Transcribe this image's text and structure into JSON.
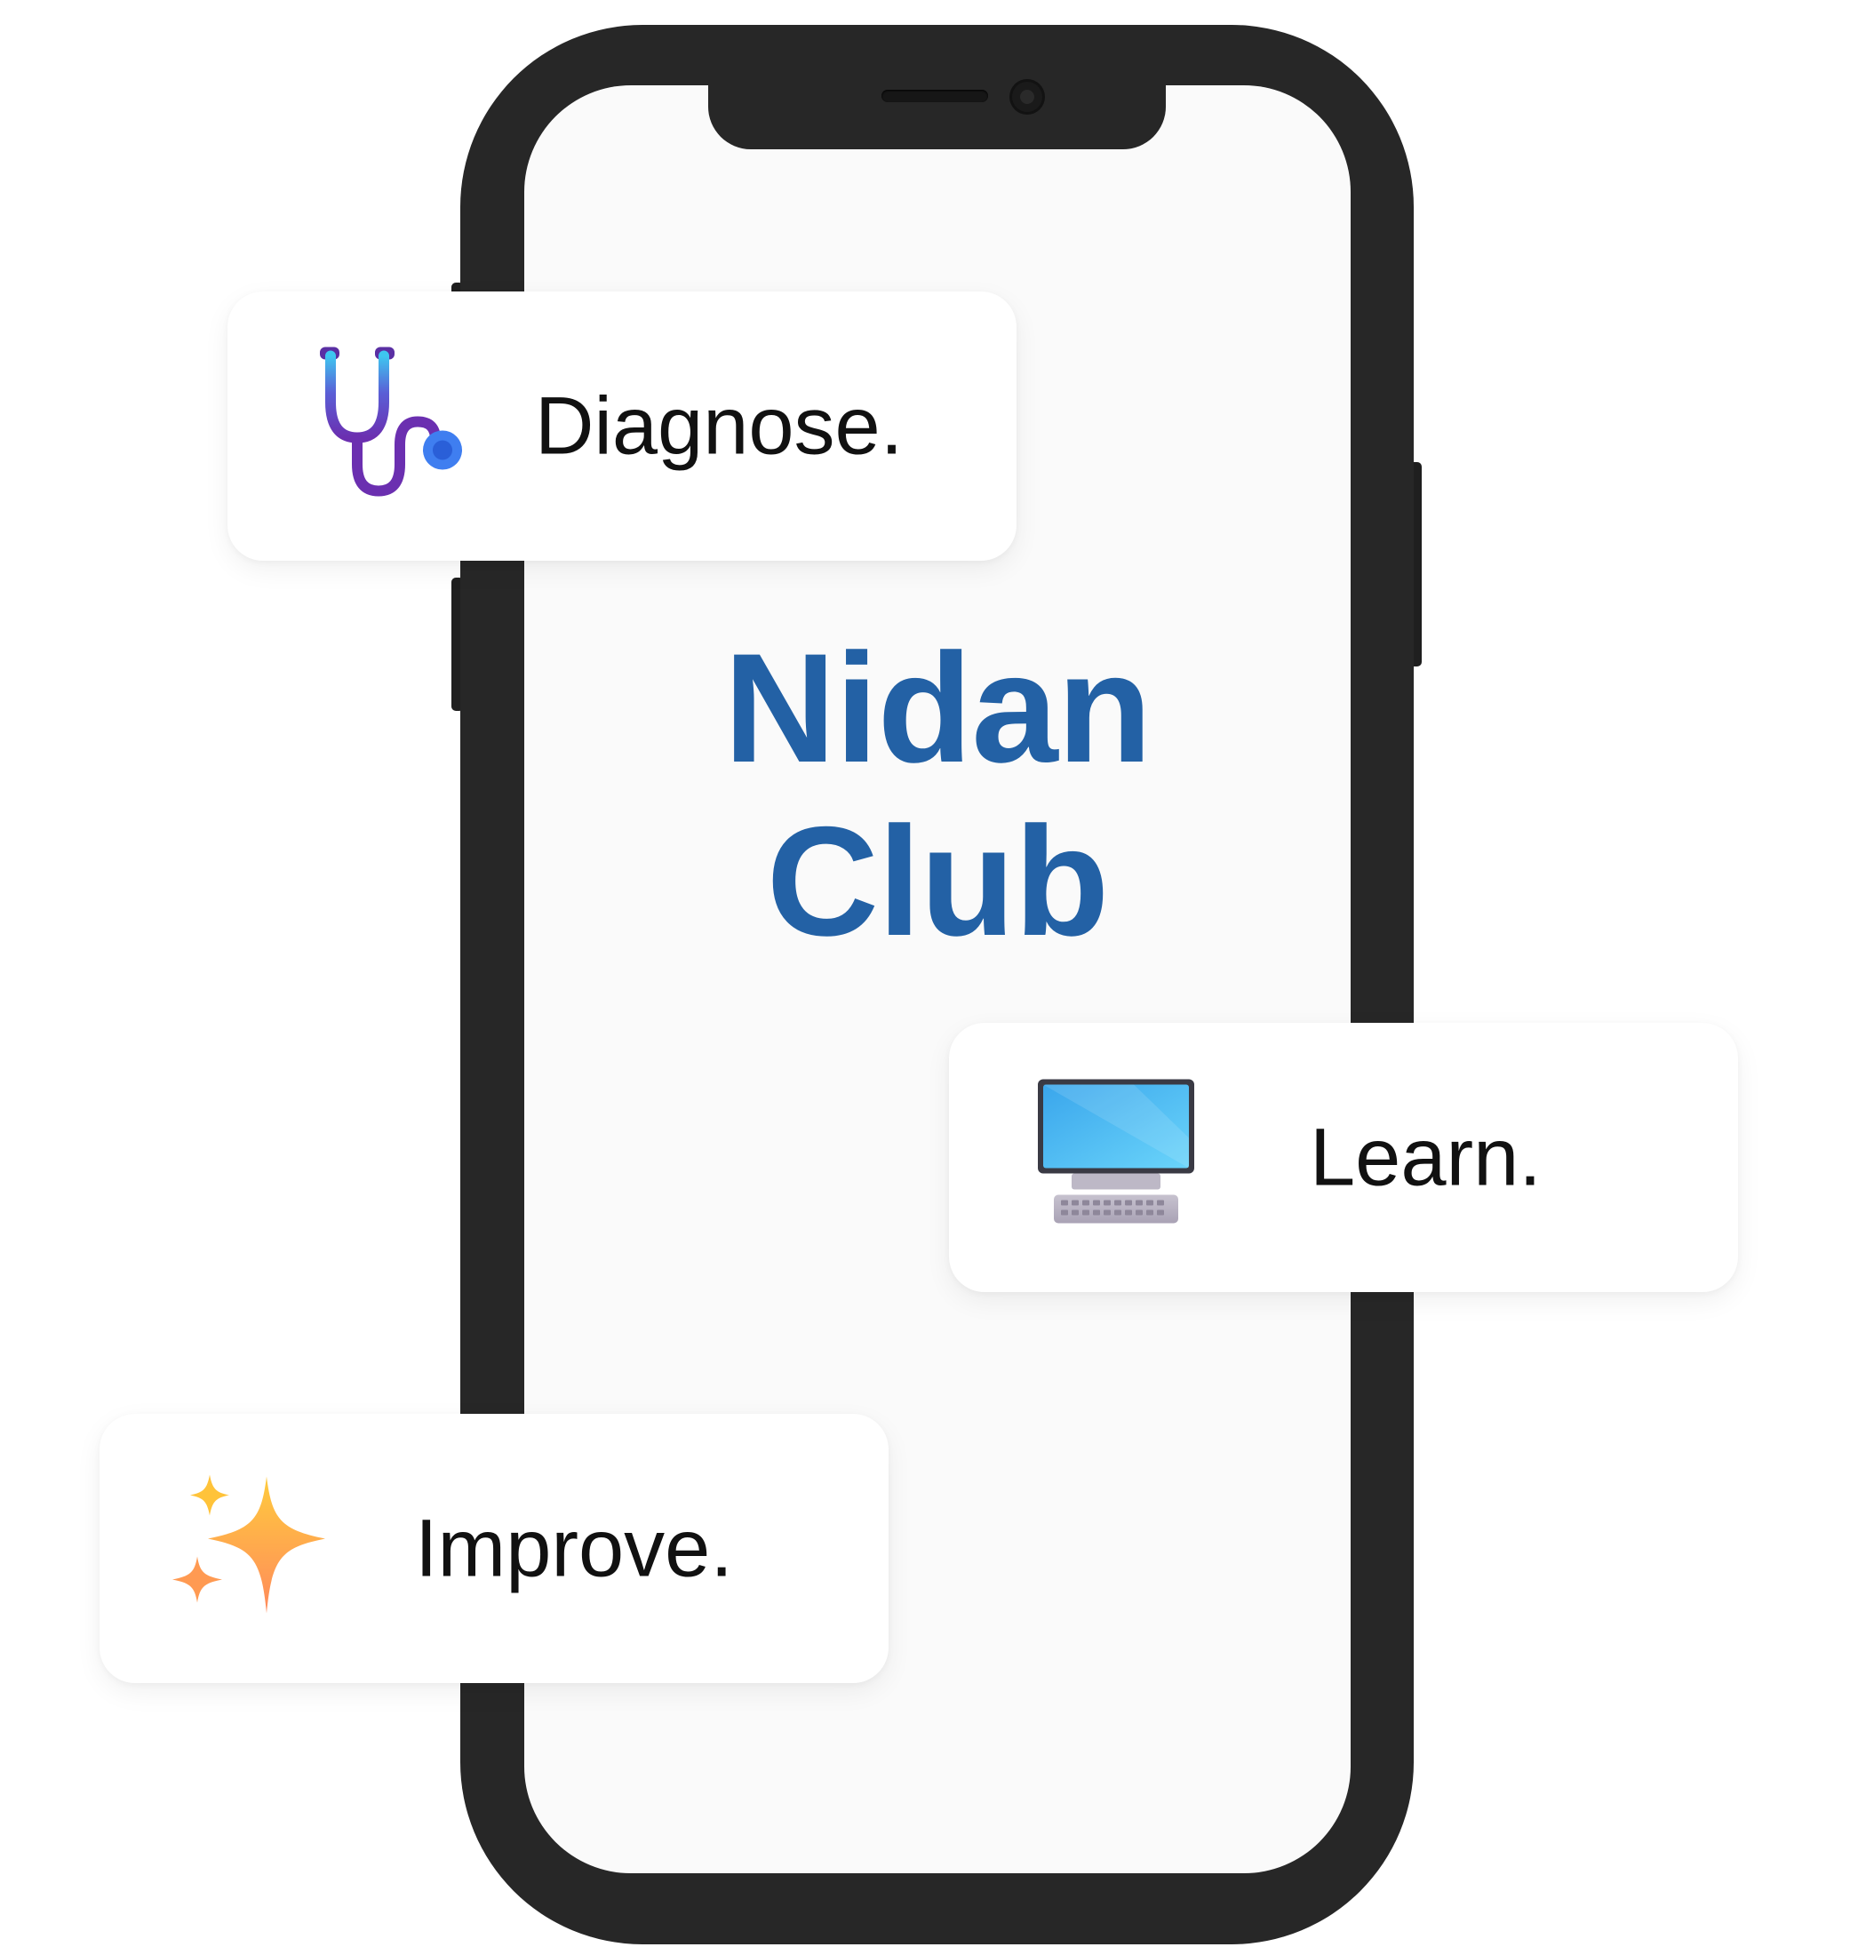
{
  "brand": {
    "line1": "Nidan",
    "line2": "Club",
    "color": "#2361a5"
  },
  "cards": [
    {
      "label": "Diagnose.",
      "icon": "stethoscope-icon"
    },
    {
      "label": "Learn.",
      "icon": "desktop-computer-icon"
    },
    {
      "label": "Improve.",
      "icon": "sparkles-icon"
    }
  ],
  "colors": {
    "phone_frame": "#272727",
    "phone_screen": "#fafafa",
    "card_background": "#ffffff",
    "label_text": "#111111"
  }
}
